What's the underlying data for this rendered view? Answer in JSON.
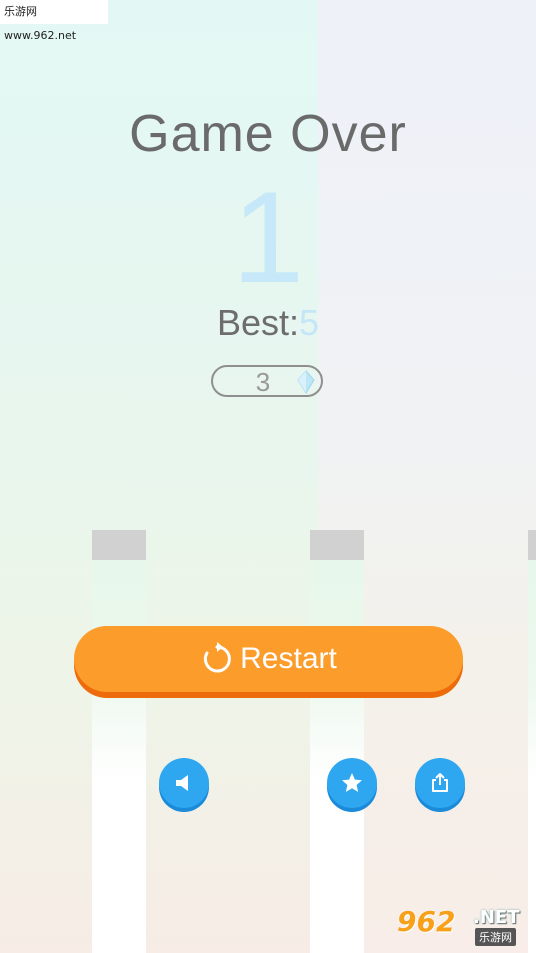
{
  "watermark": {
    "site_text": "乐游网 www.962.net",
    "logo_number": "962",
    "logo_suffix": ".NET",
    "logo_cn": "乐游网"
  },
  "game_over": {
    "title": "Game Over",
    "score": "1",
    "best_label": "Best:",
    "best_value": "5",
    "gems": "3"
  },
  "buttons": {
    "restart_label": "Restart",
    "sound_icon": "speaker-icon",
    "rate_icon": "star-icon",
    "share_icon": "share-icon"
  },
  "colors": {
    "restart": "#fc9c2a",
    "round_button": "#2fa7f0",
    "score": "#c6e8f8",
    "pillar_cap": "#d1d1d1"
  }
}
